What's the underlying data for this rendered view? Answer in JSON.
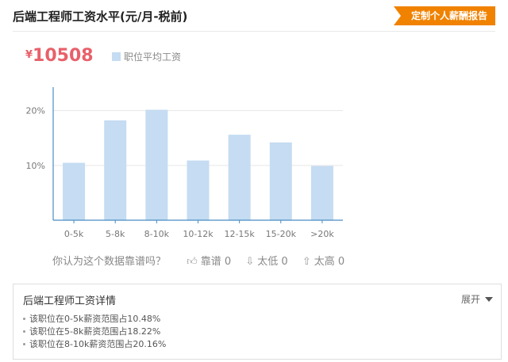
{
  "header": {
    "title": "后端工程师工资水平(元/月-税前)",
    "report_button": "定制个人薪酬报告"
  },
  "summary": {
    "currency_symbol": "¥",
    "amount": "10508",
    "legend_label": "职位平均工资"
  },
  "chart_data": {
    "type": "bar",
    "categories": [
      "0-5k",
      "5-8k",
      "8-10k",
      "10-12k",
      "12-15k",
      "15-20k",
      ">20k"
    ],
    "values": [
      10.48,
      18.22,
      20.16,
      10.9,
      15.6,
      14.2,
      9.9
    ],
    "y_ticks": [
      "10%",
      "20%"
    ],
    "ylim": [
      0,
      24
    ],
    "grid": true,
    "colors": {
      "bar": "#c5dcf2",
      "axis": "#4a8cc4",
      "grid": "#e6e6e6"
    }
  },
  "feedback": {
    "question": "你认为这个数据靠谱吗？",
    "options": [
      {
        "icon": "thumbs-up-icon",
        "label": "靠谱",
        "count": "0"
      },
      {
        "icon": "arrow-down-icon",
        "label": "太低",
        "count": "0"
      },
      {
        "icon": "arrow-up-icon",
        "label": "太高",
        "count": "0"
      }
    ]
  },
  "detail": {
    "title": "后端工程师工资详情",
    "expand_label": "展开",
    "items": [
      "该职位在0-5k薪资范围占10.48%",
      "该职位在5-8k薪资范围占18.22%",
      "该职位在8-10k薪资范围占20.16%"
    ]
  }
}
